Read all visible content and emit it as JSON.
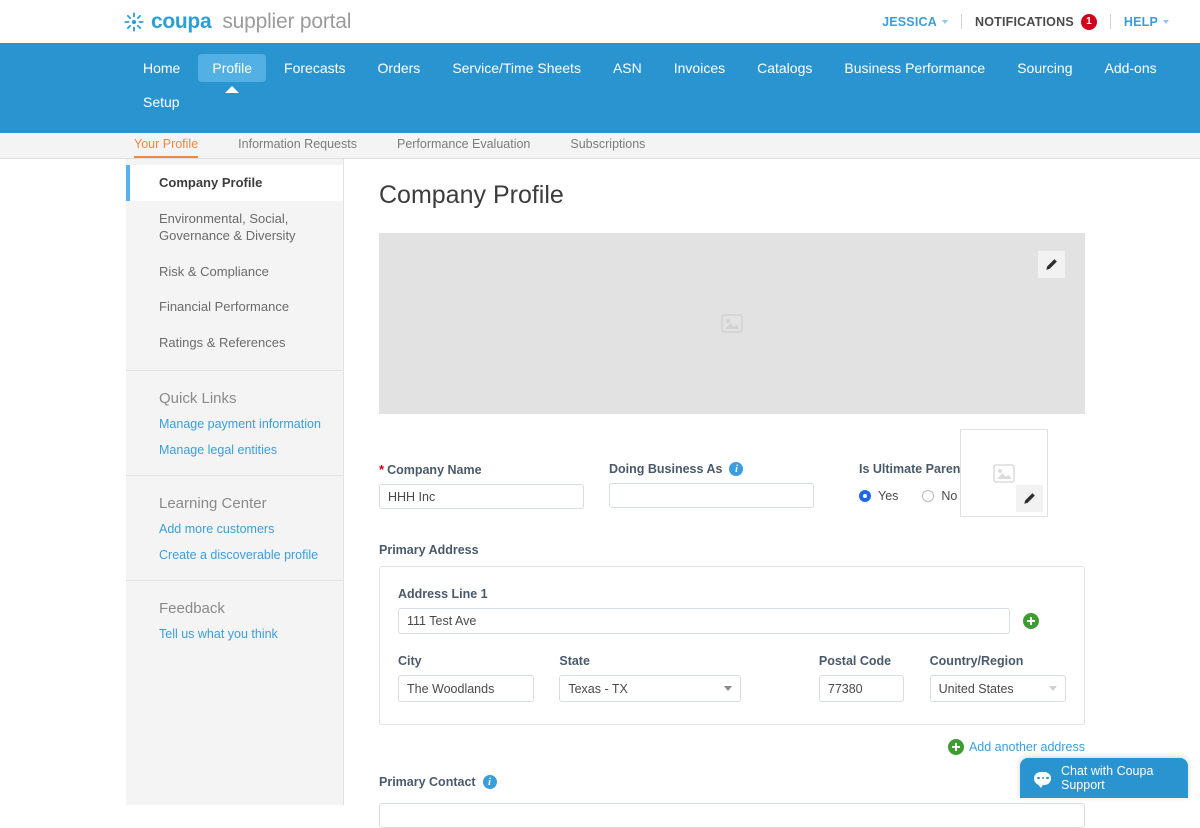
{
  "header": {
    "brand_primary": "coupa",
    "brand_secondary": "supplier portal",
    "brand_color": "#2a9fd8",
    "user_menu": "JESSICA",
    "notifications_label": "NOTIFICATIONS",
    "notifications_count": "1",
    "notifications_badge_color": "#d0021b",
    "help_menu": "HELP"
  },
  "mainnav": {
    "accent_color": "#2a94d0",
    "active_color": "#52b0e4",
    "items": [
      {
        "label": "Home",
        "active": false
      },
      {
        "label": "Profile",
        "active": true
      },
      {
        "label": "Forecasts",
        "active": false
      },
      {
        "label": "Orders",
        "active": false
      },
      {
        "label": "Service/Time Sheets",
        "active": false
      },
      {
        "label": "ASN",
        "active": false
      },
      {
        "label": "Invoices",
        "active": false
      },
      {
        "label": "Catalogs",
        "active": false
      },
      {
        "label": "Business Performance",
        "active": false
      },
      {
        "label": "Sourcing",
        "active": false
      },
      {
        "label": "Add-ons",
        "active": false
      },
      {
        "label": "Setup",
        "active": false
      }
    ]
  },
  "subnav": {
    "active_color": "#f2873d",
    "items": [
      {
        "label": "Your Profile",
        "active": true
      },
      {
        "label": "Information Requests",
        "active": false
      },
      {
        "label": "Performance Evaluation",
        "active": false
      },
      {
        "label": "Subscriptions",
        "active": false
      }
    ]
  },
  "sidenav": {
    "active_marker_color": "#57b3e8",
    "link_color": "#3b9edb",
    "profile_sections": [
      {
        "label": "Company Profile",
        "active": true
      },
      {
        "label": "Environmental, Social, Governance & Diversity",
        "active": false
      },
      {
        "label": "Risk & Compliance",
        "active": false
      },
      {
        "label": "Financial Performance",
        "active": false
      },
      {
        "label": "Ratings & References",
        "active": false
      }
    ],
    "quick_links": {
      "title": "Quick Links",
      "links": [
        {
          "label": "Manage payment information"
        },
        {
          "label": "Manage legal entities"
        }
      ]
    },
    "learning_center": {
      "title": "Learning Center",
      "links": [
        {
          "label": "Add more customers"
        },
        {
          "label": "Create a discoverable profile"
        }
      ]
    },
    "feedback": {
      "title": "Feedback",
      "links": [
        {
          "label": "Tell us what you think"
        }
      ]
    }
  },
  "main": {
    "page_title": "Company Profile",
    "banner": {
      "placeholder_icon": "image-placeholder-icon",
      "edit_icon": "pencil-icon"
    },
    "logo": {
      "placeholder_icon": "image-placeholder-icon",
      "edit_icon": "pencil-icon"
    },
    "form": {
      "company_name": {
        "label": "Company Name",
        "required_marker": "*",
        "value": "HHH Inc",
        "placeholder": ""
      },
      "doing_business_as": {
        "label": "Doing Business As",
        "value": "",
        "placeholder": "",
        "info_icon": "info-icon"
      },
      "is_ultimate_parent": {
        "label": "Is Ultimate Parent",
        "options": [
          {
            "label": "Yes",
            "selected": true
          },
          {
            "label": "No",
            "selected": false
          }
        ]
      },
      "primary_address": {
        "section_label": "Primary Address",
        "address_line_1": {
          "label": "Address Line 1",
          "value": "111 Test Ave",
          "placeholder": ""
        },
        "add_line_icon": "plus-circle-icon",
        "city": {
          "label": "City",
          "value": "The Woodlands",
          "placeholder": ""
        },
        "state": {
          "label": "State",
          "value": "Texas - TX"
        },
        "postal_code": {
          "label": "Postal Code",
          "value": "77380",
          "placeholder": ""
        },
        "country_region": {
          "label": "Country/Region",
          "value": "United States"
        }
      },
      "add_another_address": {
        "label": "Add another address",
        "icon": "plus-circle-icon",
        "color": "#3b9edb"
      },
      "primary_contact": {
        "label": "Primary Contact",
        "info_icon": "info-icon",
        "value": "",
        "placeholder": ""
      }
    }
  },
  "chat": {
    "label": "Chat with Coupa Support",
    "icon": "chat-bubble-icon",
    "color": "#2a94d0"
  }
}
